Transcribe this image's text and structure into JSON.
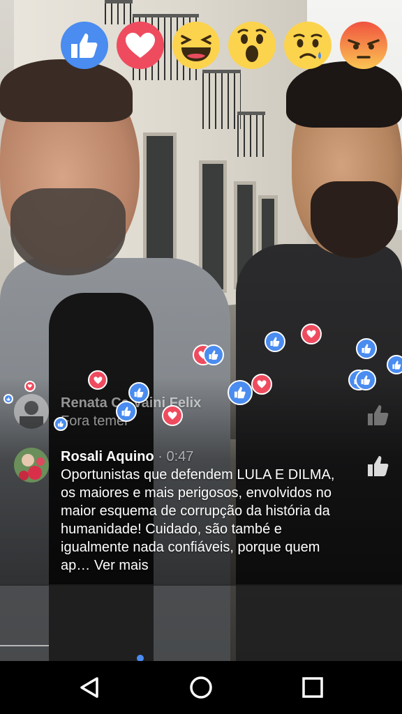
{
  "comments": [
    {
      "name": "Renata Ca Vaini Felix",
      "text": "Fora temer",
      "faded": true
    },
    {
      "name": "Rosali Aquino",
      "time": "· 0:47",
      "text": "Oportunistas que defendem LULA E DILMA, os maiores e mais perigosos, envolvidos no maior esquema de corrupção da história da humanidade! Cuidado, são també e igualmente nada confiáveis, porque quem ap…",
      "more_label": "Ver mais"
    }
  ],
  "reactions": [
    {
      "name": "like",
      "color": "#4a8cf0"
    },
    {
      "name": "love",
      "color": "#ef4b5f"
    },
    {
      "name": "haha",
      "color": "#fcd34d"
    },
    {
      "name": "wow",
      "color": "#fcd34d"
    },
    {
      "name": "sad",
      "color": "#fcd34d"
    },
    {
      "name": "angry",
      "color": "#f5713d"
    }
  ],
  "selected_reaction": "love",
  "floating_reactions": [
    "like",
    "love",
    "like",
    "like",
    "love",
    "like",
    "love",
    "like",
    "like",
    "love",
    "like",
    "love",
    "like",
    "like",
    "love"
  ],
  "nav": {
    "back": "back-icon",
    "home": "home-icon",
    "recents": "recents-icon"
  }
}
